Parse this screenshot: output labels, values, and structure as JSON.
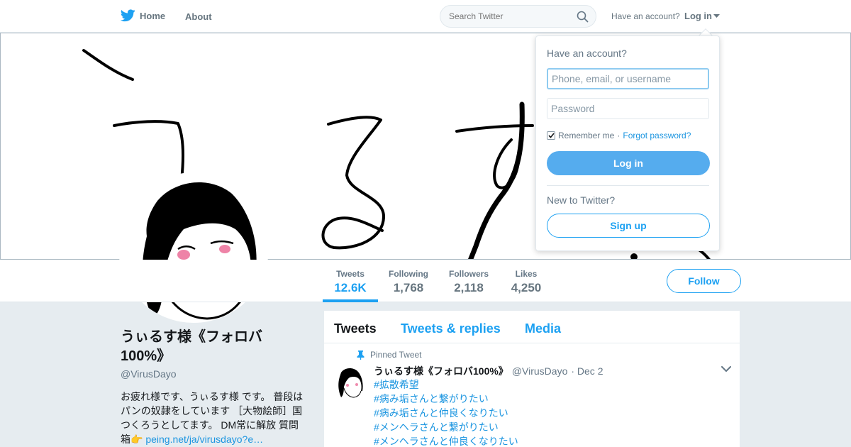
{
  "nav": {
    "home_label": "Home",
    "about_label": "About",
    "search_placeholder": "Search Twitter",
    "have_account": "Have an account?",
    "login_label": "Log in"
  },
  "profile": {
    "name": "うぃるす様《フォロバ100%》",
    "handle": "@VirusDayo",
    "bio": "お疲れ様です、うぃるす様 です。 普段はパンの奴隷をしています ［大物絵師］国つくろうとしてます。 DM常に解放 質問箱👉 ",
    "bio_link": "peing.net/ja/virusdayo?e…"
  },
  "stats": [
    {
      "label": "Tweets",
      "value": "12.6K"
    },
    {
      "label": "Following",
      "value": "1,768"
    },
    {
      "label": "Followers",
      "value": "2,118"
    },
    {
      "label": "Likes",
      "value": "4,250"
    }
  ],
  "follow_label": "Follow",
  "timeline": {
    "tabs": [
      "Tweets",
      "Tweets & replies",
      "Media"
    ],
    "pinned_label": "Pinned Tweet",
    "tweet": {
      "name": "うぃるす様《フォロバ100%》",
      "handle": "@VirusDayo",
      "date": "· Dec 2",
      "hashtags": [
        "#拡散希望",
        "#病み垢さんと繋がりたい",
        "#病み垢さんと仲良くなりたい",
        "#メンヘラさんと繋がりたい",
        "#メンヘラさんと仲良くなりたい"
      ]
    }
  },
  "login": {
    "title": "Have an account?",
    "username_placeholder": "Phone, email, or username",
    "password_placeholder": "Password",
    "remember_label": "Remember me",
    "separator": "·",
    "forgot_label": "Forgot password?",
    "button_label": "Log in",
    "new_to": "New to Twitter?",
    "signup_label": "Sign up"
  },
  "colors": {
    "brand_blue": "#1da1f2",
    "link_blue": "#1b95e0",
    "login_button": "#55acee",
    "page_background": "#e6ecf0"
  },
  "icons": [
    "twitter-bird-icon",
    "search-icon",
    "caret-down-icon",
    "pin-icon",
    "chevron-down-icon",
    "checkmark-icon"
  ]
}
